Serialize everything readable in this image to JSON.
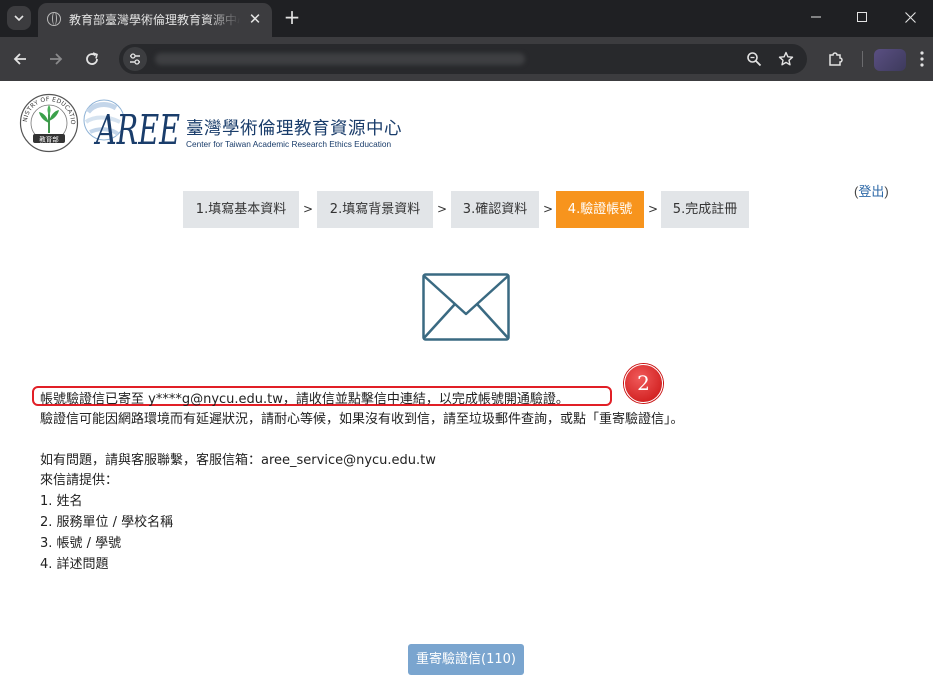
{
  "browser": {
    "tab_title": "教育部臺灣學術倫理教育資源中心",
    "new_tab_symbol": "+",
    "tab_close_symbol": "✕",
    "window_controls": [
      "minimize",
      "maximize",
      "close"
    ]
  },
  "header": {
    "org_name": "臺灣學術倫理教育資源中心",
    "org_subtitle": "Center for Taiwan Academic Research Ethics Education",
    "moe_logo_text": "MINISTRY OF EDUCATION",
    "moe_logo_chars": "教育部",
    "aree_logo_text": "AREE",
    "logout_open": "(",
    "logout_label": "登出",
    "logout_close": ")"
  },
  "steps": [
    {
      "label": "1.填寫基本資料",
      "active": false
    },
    {
      "label": "2.填寫背景資料",
      "active": false
    },
    {
      "label": "3.確認資料",
      "active": false
    },
    {
      "label": "4.驗證帳號",
      "active": true
    },
    {
      "label": "5.完成註冊",
      "active": false
    }
  ],
  "step_separator": ">",
  "message": {
    "verification_sent": "帳號驗證信已寄至 y****g@nycu.edu.tw，請收信並點擊信中連結，以完成帳號開通驗證。",
    "delay_notice": "驗證信可能因網路環境而有延遲狀況，請耐心等候，如果沒有收到信，請至垃圾郵件查詢，或點「重寄驗證信」。",
    "contact": "如有問題，請與客服聯繫，客服信箱：aree_service@nycu.edu.tw",
    "provide_intro": "來信請提供：",
    "provide_items": [
      "1. 姓名",
      "2. 服務單位 / 學校名稱",
      "3. 帳號 / 學號",
      "4. 詳述問題"
    ]
  },
  "annotation_badge": "2",
  "resend_button_label": "重寄驗證信(110)",
  "colors": {
    "active_step": "#f7941d",
    "inactive_step": "#e2e5e8",
    "annotation_red": "#e11f26",
    "button_blue": "#7aa5cf",
    "envelope_stroke": "#3a6a82",
    "brand_navy": "#1a3d6b"
  }
}
